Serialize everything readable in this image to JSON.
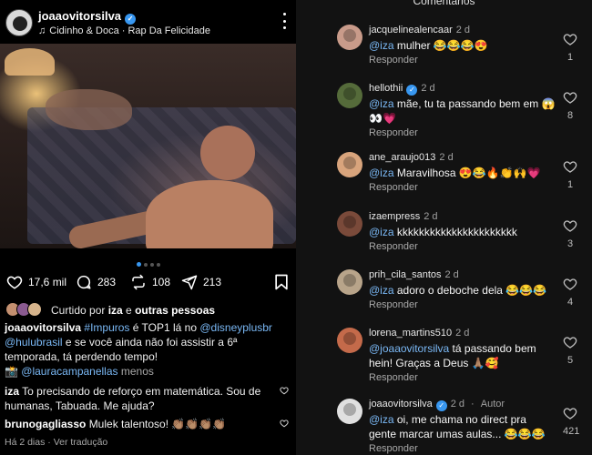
{
  "post": {
    "username": "joaaovitorsilva",
    "music": "Cidinho & Doca · Rap Da Felicidade",
    "likes": "17,6 mil",
    "comments": "283",
    "reposts": "108",
    "shares": "213",
    "liked_by_prefix": "Curtido por ",
    "liked_by_user": "iza",
    "liked_by_mid": " e ",
    "liked_by_others": "outras pessoas",
    "caption": {
      "username": "joaaovitorsilva",
      "hashtag": "#Impuros",
      "t1": " é TOP1 lá no ",
      "mention1": "@disneyplusbr",
      "mention2": "@hulubrasil",
      "t2": " e se você ainda não foi assistir a 6ª temporada, tá perdendo tempo!",
      "camera": "📸 ",
      "mention3": "@lauracampanellas",
      "more": "menos"
    },
    "comments_list": [
      {
        "username": "iza",
        "text": "To precisando de reforço em matemática. Sou de humanas, Tabuada. Me ajuda?"
      },
      {
        "username": "brunogagliasso",
        "text": "Mulek talentoso! 👏🏽👏🏽👏🏽👏🏽"
      }
    ],
    "meta_time": "Há 2 dias",
    "meta_sep": " · ",
    "meta_translate": "Ver tradução"
  },
  "comments_panel": {
    "title": "Comentários",
    "items": [
      {
        "username": "jacquelinealencaar",
        "time": "2 d",
        "mention": "@iza",
        "text": " mulher 😂😂😂😍",
        "reply": "Responder",
        "likes": "1",
        "avatar_color": "#c99b8a"
      },
      {
        "username": "hellothii",
        "time": "2 d",
        "mention": "@iza",
        "text": " mãe, tu ta passando bem em 😱👀💗",
        "reply": "Responder",
        "likes": "8",
        "avatar_color": "#556b3a",
        "verified": true
      },
      {
        "username": "ane_araujo013",
        "time": "2 d",
        "mention": "@iza",
        "text": " Maravilhosa 😍😂🔥👏🙌💗",
        "reply": "Responder",
        "likes": "1",
        "avatar_color": "#d8a47c"
      },
      {
        "username": "izaempress",
        "time": "2 d",
        "mention": "@iza",
        "text": " kkkkkkkkkkkkkkkkkkkkkk",
        "reply": "Responder",
        "likes": "3",
        "avatar_color": "#7a4a3a"
      },
      {
        "username": "prih_cila_santos",
        "time": "2 d",
        "mention": "@iza",
        "text": " adoro o deboche dela 😂😂😂",
        "reply": "Responder",
        "likes": "4",
        "avatar_color": "#b8a48a"
      },
      {
        "username": "lorena_martins510",
        "time": "2 d",
        "mention": "@joaaovitorsilva",
        "text": " tá passando bem hein! Graças a Deus 🙏🏽🥰",
        "reply": "Responder",
        "likes": "5",
        "avatar_color": "#c46a4a"
      },
      {
        "username": "joaaovitorsilva",
        "time": "2 d",
        "author": "Autor",
        "mention": "@iza",
        "text": " oi, me chama no direct pra gente marcar umas aulas... 😂😂😂",
        "reply": "Responder",
        "likes": "421",
        "avatar_color": "#e0e0e0",
        "verified": true
      }
    ]
  },
  "colors": {
    "link": "#7ab8f5",
    "verified": "#3897f0",
    "panel_bg": "#121212"
  }
}
